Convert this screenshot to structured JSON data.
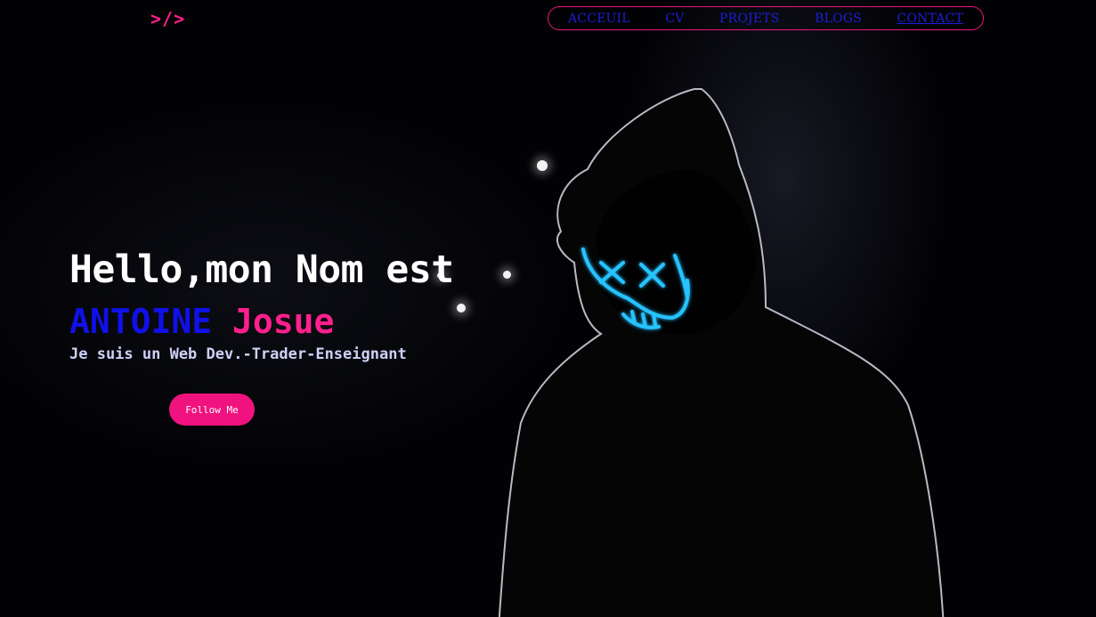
{
  "logo": {
    "text": ">/>"
  },
  "nav": {
    "items": [
      {
        "label": "ACCEUIL"
      },
      {
        "label": "CV"
      },
      {
        "label": "PROJETS"
      },
      {
        "label": "BLOGS"
      },
      {
        "label": "CONTACT"
      }
    ],
    "active": "CONTACT"
  },
  "hero": {
    "title": "Hello,mon Nom est",
    "first_name": "ANTOINE",
    "last_name": "Josue",
    "subtitle": "Je suis un Web Dev.-Trader-Enseignant",
    "button_label": "Follow Me"
  },
  "colors": {
    "accent_pink": "#ff1f8e",
    "accent_blue": "#1010e8",
    "nav_link": "#1a1fd8",
    "mask_neon": "#27c3ff",
    "background": "#000000"
  },
  "background_image": {
    "subject": "hooded-figure-neon-mask-icon"
  }
}
